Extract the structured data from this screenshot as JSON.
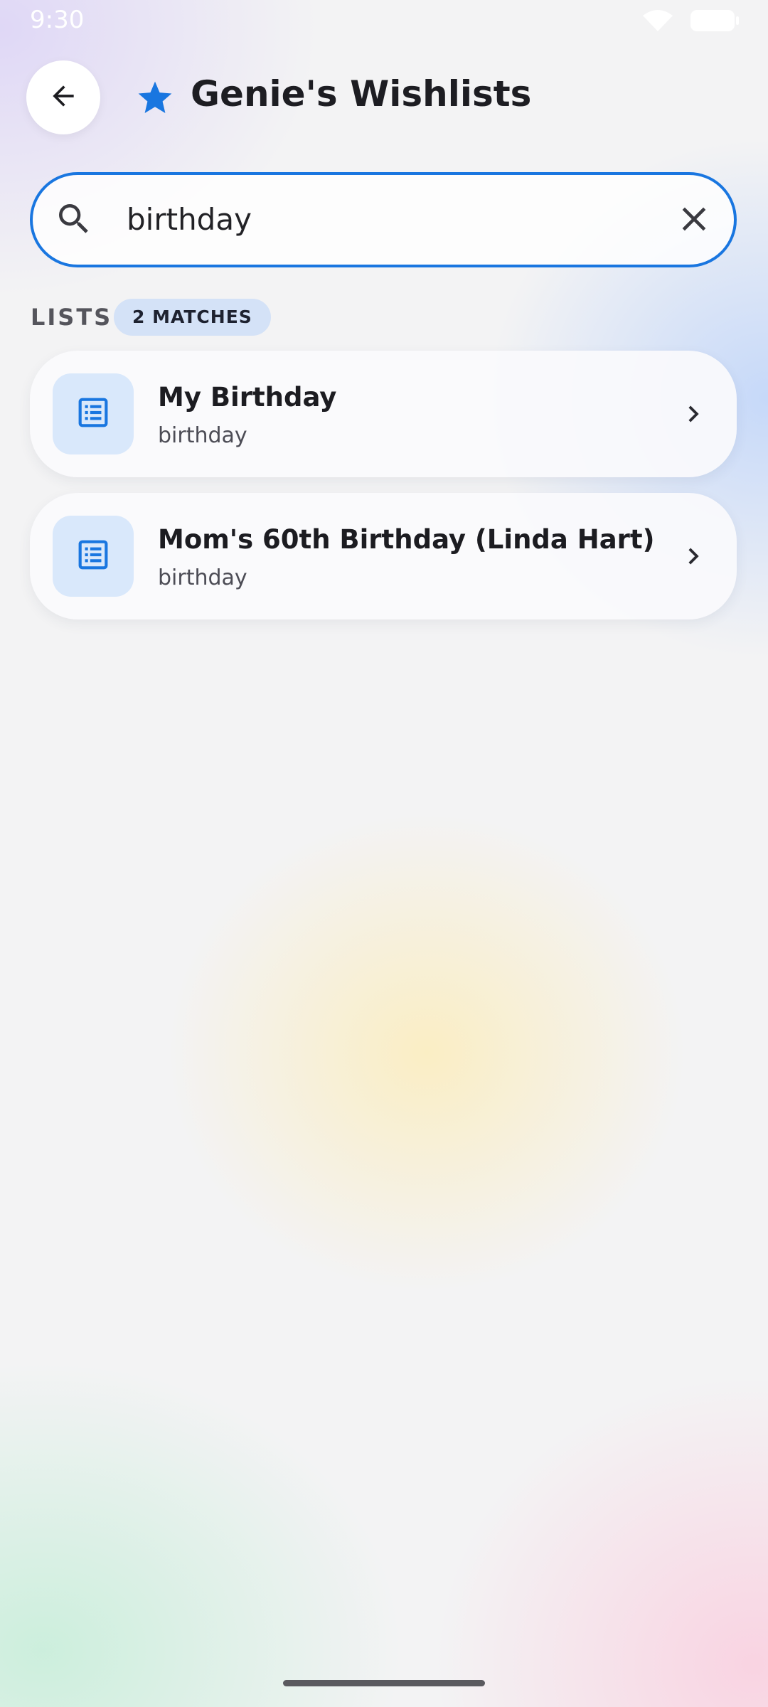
{
  "status_bar": {
    "time": "9:30",
    "icons": [
      "wifi-icon",
      "battery-icon"
    ]
  },
  "header": {
    "back_icon": "arrow-left-icon",
    "title_icon": "star-icon",
    "title": "Genie's Wishlists"
  },
  "search": {
    "value": "birthday",
    "placeholder": "",
    "search_icon": "search-icon",
    "clear_icon": "close-icon"
  },
  "section": {
    "label": "LISTS",
    "badge": "2 MATCHES"
  },
  "lists": [
    {
      "title": "My Birthday",
      "subtitle": "birthday",
      "icon": "list-icon"
    },
    {
      "title": "Mom's 60th Birthday (Linda Hart)",
      "subtitle": "birthday",
      "icon": "list-icon"
    }
  ],
  "colors": {
    "accent": "#1976e0",
    "badge_bg": "#d4e2f7",
    "icon_tile_bg": "#d9e8fb"
  }
}
